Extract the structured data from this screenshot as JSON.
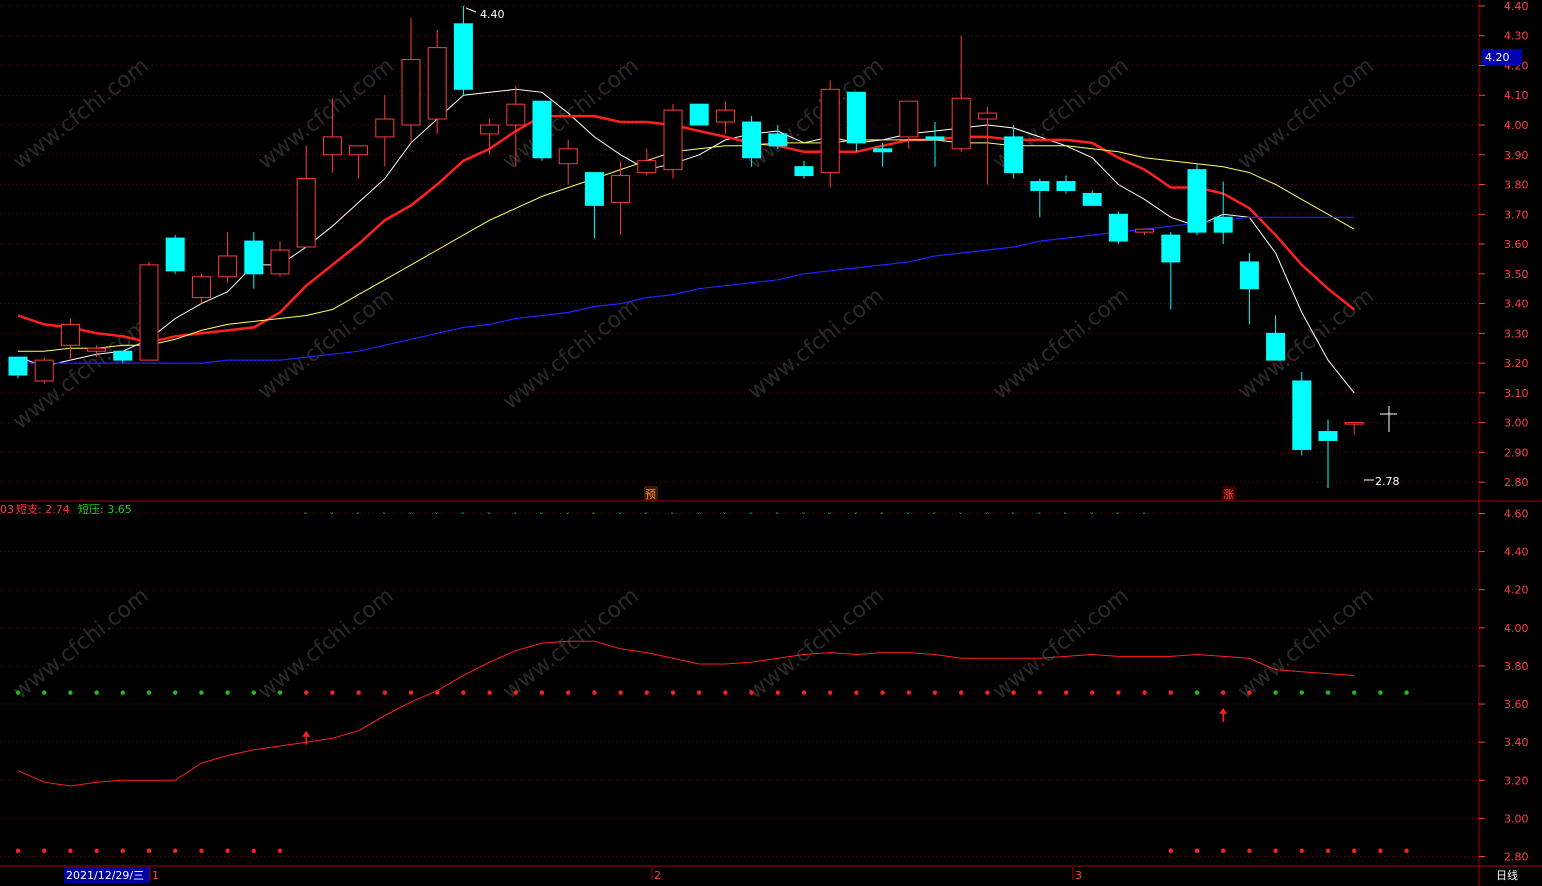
{
  "colors": {
    "up": "#ff3b3b",
    "down": "#00ffff",
    "ma5": "#ffffff",
    "ma10": "#ff2020",
    "ma20": "#ffff66",
    "ma60": "#2222ff",
    "axis_text": "#ff4040",
    "grid": "#7a0000",
    "panel_border": "#b00000"
  },
  "price_axis": {
    "ticks": [
      "4.40",
      "4.30",
      "4.20",
      "4.10",
      "4.00",
      "3.90",
      "3.80",
      "3.70",
      "3.60",
      "3.50",
      "3.40",
      "3.30",
      "3.20",
      "3.10",
      "3.00",
      "2.90",
      "2.80"
    ],
    "current_price": "4.20",
    "ylim": [
      2.74,
      4.42
    ]
  },
  "indicator_axis": {
    "ticks": [
      "4.60",
      "4.40",
      "4.20",
      "4.00",
      "3.80",
      "3.60",
      "3.40",
      "3.20",
      "3.00",
      "2.80"
    ],
    "ylim": [
      2.75,
      4.65
    ]
  },
  "annotations": {
    "high_label": "4.40",
    "low_label": "2.78",
    "marker_pre": "预",
    "marker_rise": "涨"
  },
  "indicator_legend": {
    "prefix": "03",
    "support_label": "短支: 2.74",
    "resistance_label": "短压: 3.65"
  },
  "date_bar": {
    "selected_date": "2021/12/29/三",
    "month_labels": [
      "1",
      "2",
      "3"
    ],
    "period": "日线"
  },
  "watermark": "www.cfchi.com",
  "chart_data": {
    "type": "candlestick",
    "title": "",
    "ohlc": [
      [
        3.22,
        3.22,
        3.15,
        3.16
      ],
      [
        3.14,
        3.22,
        3.13,
        3.21
      ],
      [
        3.26,
        3.35,
        3.21,
        3.33
      ],
      [
        3.24,
        3.26,
        3.22,
        3.25
      ],
      [
        3.24,
        3.24,
        3.2,
        3.21
      ],
      [
        3.21,
        3.54,
        3.21,
        3.53
      ],
      [
        3.62,
        3.63,
        3.5,
        3.51
      ],
      [
        3.42,
        3.5,
        3.4,
        3.49
      ],
      [
        3.49,
        3.64,
        3.47,
        3.56
      ],
      [
        3.61,
        3.64,
        3.45,
        3.5
      ],
      [
        3.5,
        3.61,
        3.49,
        3.58
      ],
      [
        3.59,
        3.93,
        3.59,
        3.82
      ],
      [
        3.9,
        4.09,
        3.84,
        3.96
      ],
      [
        3.9,
        3.92,
        3.82,
        3.93
      ],
      [
        3.96,
        4.1,
        3.86,
        4.02
      ],
      [
        4.0,
        4.36,
        3.94,
        4.22
      ],
      [
        4.02,
        4.32,
        3.97,
        4.26
      ],
      [
        4.34,
        4.4,
        4.1,
        4.12
      ],
      [
        3.97,
        4.02,
        3.9,
        4.0
      ],
      [
        4.0,
        4.13,
        3.86,
        4.07
      ],
      [
        4.08,
        4.08,
        3.88,
        3.89
      ],
      [
        3.87,
        3.95,
        3.8,
        3.92
      ],
      [
        3.84,
        3.84,
        3.62,
        3.73
      ],
      [
        3.74,
        3.88,
        3.63,
        3.83
      ],
      [
        3.84,
        3.92,
        3.83,
        3.88
      ],
      [
        3.85,
        4.07,
        3.82,
        4.05
      ],
      [
        4.07,
        4.07,
        4.0,
        4.0
      ],
      [
        4.01,
        4.08,
        3.97,
        4.05
      ],
      [
        4.01,
        4.03,
        3.86,
        3.89
      ],
      [
        3.97,
        4.0,
        3.92,
        3.93
      ],
      [
        3.86,
        3.88,
        3.82,
        3.83
      ],
      [
        3.84,
        4.15,
        3.79,
        4.12
      ],
      [
        4.11,
        4.11,
        3.91,
        3.94
      ],
      [
        3.92,
        3.94,
        3.86,
        3.91
      ],
      [
        3.96,
        4.08,
        3.92,
        4.08
      ],
      [
        3.96,
        4.01,
        3.86,
        3.95
      ],
      [
        3.92,
        4.3,
        3.91,
        4.09
      ],
      [
        4.02,
        4.06,
        3.8,
        4.04
      ],
      [
        3.96,
        4.0,
        3.82,
        3.84
      ],
      [
        3.81,
        3.82,
        3.69,
        3.78
      ],
      [
        3.81,
        3.83,
        3.77,
        3.78
      ],
      [
        3.77,
        3.78,
        3.73,
        3.73
      ],
      [
        3.7,
        3.71,
        3.6,
        3.61
      ],
      [
        3.64,
        3.64,
        3.63,
        3.65
      ],
      [
        3.63,
        3.64,
        3.38,
        3.54
      ],
      [
        3.85,
        3.87,
        3.63,
        3.64
      ],
      [
        3.69,
        3.81,
        3.6,
        3.64
      ],
      [
        3.54,
        3.57,
        3.33,
        3.45
      ],
      [
        3.3,
        3.36,
        3.21,
        3.21
      ],
      [
        3.14,
        3.17,
        2.89,
        2.91
      ],
      [
        2.97,
        3.01,
        2.78,
        2.94
      ],
      [
        3.0,
        3.0,
        2.96,
        3.0
      ]
    ],
    "ma": [
      {
        "name": "MA5",
        "values": [
          3.22,
          3.19,
          3.21,
          3.23,
          3.24,
          3.28,
          3.35,
          3.4,
          3.44,
          3.53,
          3.53,
          3.59,
          3.66,
          3.74,
          3.82,
          3.94,
          4.02,
          4.1,
          4.11,
          4.12,
          4.11,
          4.04,
          3.96,
          3.9,
          3.85,
          3.87,
          3.9,
          3.95,
          3.97,
          3.98,
          3.94,
          3.96,
          3.94,
          3.95,
          3.97,
          3.98,
          3.99,
          4.0,
          3.99,
          3.96,
          3.93,
          3.89,
          3.8,
          3.75,
          3.69,
          3.66,
          3.7,
          3.69,
          3.57,
          3.37,
          3.21,
          3.1
        ]
      },
      {
        "name": "MA10",
        "values": [
          3.36,
          3.33,
          3.32,
          3.3,
          3.29,
          3.27,
          3.29,
          3.3,
          3.31,
          3.32,
          3.37,
          3.46,
          3.53,
          3.6,
          3.68,
          3.73,
          3.8,
          3.88,
          3.92,
          3.98,
          4.03,
          4.03,
          4.03,
          4.01,
          4.01,
          4.0,
          3.98,
          3.96,
          3.94,
          3.93,
          3.91,
          3.91,
          3.91,
          3.93,
          3.95,
          3.95,
          3.96,
          3.96,
          3.95,
          3.95,
          3.95,
          3.94,
          3.89,
          3.85,
          3.79,
          3.79,
          3.77,
          3.72,
          3.63,
          3.53,
          3.45,
          3.38
        ]
      },
      {
        "name": "MA20",
        "values": [
          3.24,
          3.24,
          3.25,
          3.25,
          3.26,
          3.26,
          3.28,
          3.31,
          3.33,
          3.34,
          3.35,
          3.36,
          3.38,
          3.43,
          3.48,
          3.53,
          3.58,
          3.63,
          3.68,
          3.72,
          3.76,
          3.79,
          3.82,
          3.85,
          3.88,
          3.91,
          3.92,
          3.93,
          3.93,
          3.94,
          3.94,
          3.94,
          3.95,
          3.95,
          3.95,
          3.95,
          3.94,
          3.94,
          3.93,
          3.93,
          3.93,
          3.92,
          3.91,
          3.89,
          3.88,
          3.87,
          3.86,
          3.84,
          3.8,
          3.75,
          3.7,
          3.65
        ]
      },
      {
        "name": "MA60",
        "values": [
          3.2,
          3.2,
          3.2,
          3.2,
          3.2,
          3.2,
          3.2,
          3.2,
          3.21,
          3.21,
          3.21,
          3.22,
          3.23,
          3.24,
          3.26,
          3.28,
          3.3,
          3.32,
          3.33,
          3.35,
          3.36,
          3.37,
          3.39,
          3.4,
          3.42,
          3.43,
          3.45,
          3.46,
          3.47,
          3.48,
          3.5,
          3.51,
          3.52,
          3.53,
          3.54,
          3.56,
          3.57,
          3.58,
          3.59,
          3.61,
          3.62,
          3.63,
          3.64,
          3.65,
          3.66,
          3.67,
          3.68,
          3.69,
          3.69,
          3.69,
          3.69,
          3.69
        ]
      }
    ],
    "indicator_line": [
      3.25,
      3.19,
      3.17,
      3.19,
      3.2,
      3.2,
      3.2,
      3.29,
      3.33,
      3.36,
      3.38,
      3.4,
      3.42,
      3.46,
      3.54,
      3.61,
      3.67,
      3.75,
      3.82,
      3.88,
      3.92,
      3.93,
      3.93,
      3.89,
      3.87,
      3.84,
      3.81,
      3.81,
      3.82,
      3.84,
      3.86,
      3.87,
      3.86,
      3.87,
      3.87,
      3.86,
      3.84,
      3.84,
      3.84,
      3.84,
      3.85,
      3.86,
      3.85,
      3.85,
      3.85,
      3.86,
      3.85,
      3.84,
      3.78,
      3.77,
      3.76,
      3.75
    ],
    "indicator_dots": {
      "upper_level": 3.66,
      "upper_colors": [
        "g",
        "g",
        "g",
        "g",
        "g",
        "g",
        "g",
        "g",
        "g",
        "g",
        "g",
        "r",
        "r",
        "r",
        "r",
        "r",
        "r",
        "r",
        "r",
        "r",
        "r",
        "r",
        "r",
        "r",
        "r",
        "r",
        "r",
        "r",
        "r",
        "r",
        "r",
        "r",
        "r",
        "r",
        "r",
        "r",
        "r",
        "r",
        "r",
        "r",
        "r",
        "r",
        "r",
        "r",
        "r",
        "g",
        "r",
        "r",
        "g",
        "g",
        "g",
        "g",
        "g",
        "g"
      ],
      "lower_level": 2.83,
      "lower_active": [
        1,
        1,
        1,
        1,
        1,
        1,
        1,
        1,
        1,
        1,
        1,
        0,
        0,
        0,
        0,
        0,
        0,
        0,
        0,
        0,
        0,
        0,
        0,
        0,
        0,
        0,
        0,
        0,
        0,
        0,
        0,
        0,
        0,
        0,
        0,
        0,
        0,
        0,
        0,
        0,
        0,
        0,
        0,
        0,
        1,
        1,
        1,
        1,
        1,
        1,
        1,
        1,
        1,
        1
      ]
    },
    "green_ticks_level": 4.59,
    "arrows": [
      {
        "index": 11,
        "value": 3.46
      },
      {
        "index": 46,
        "value": 3.58
      }
    ]
  }
}
